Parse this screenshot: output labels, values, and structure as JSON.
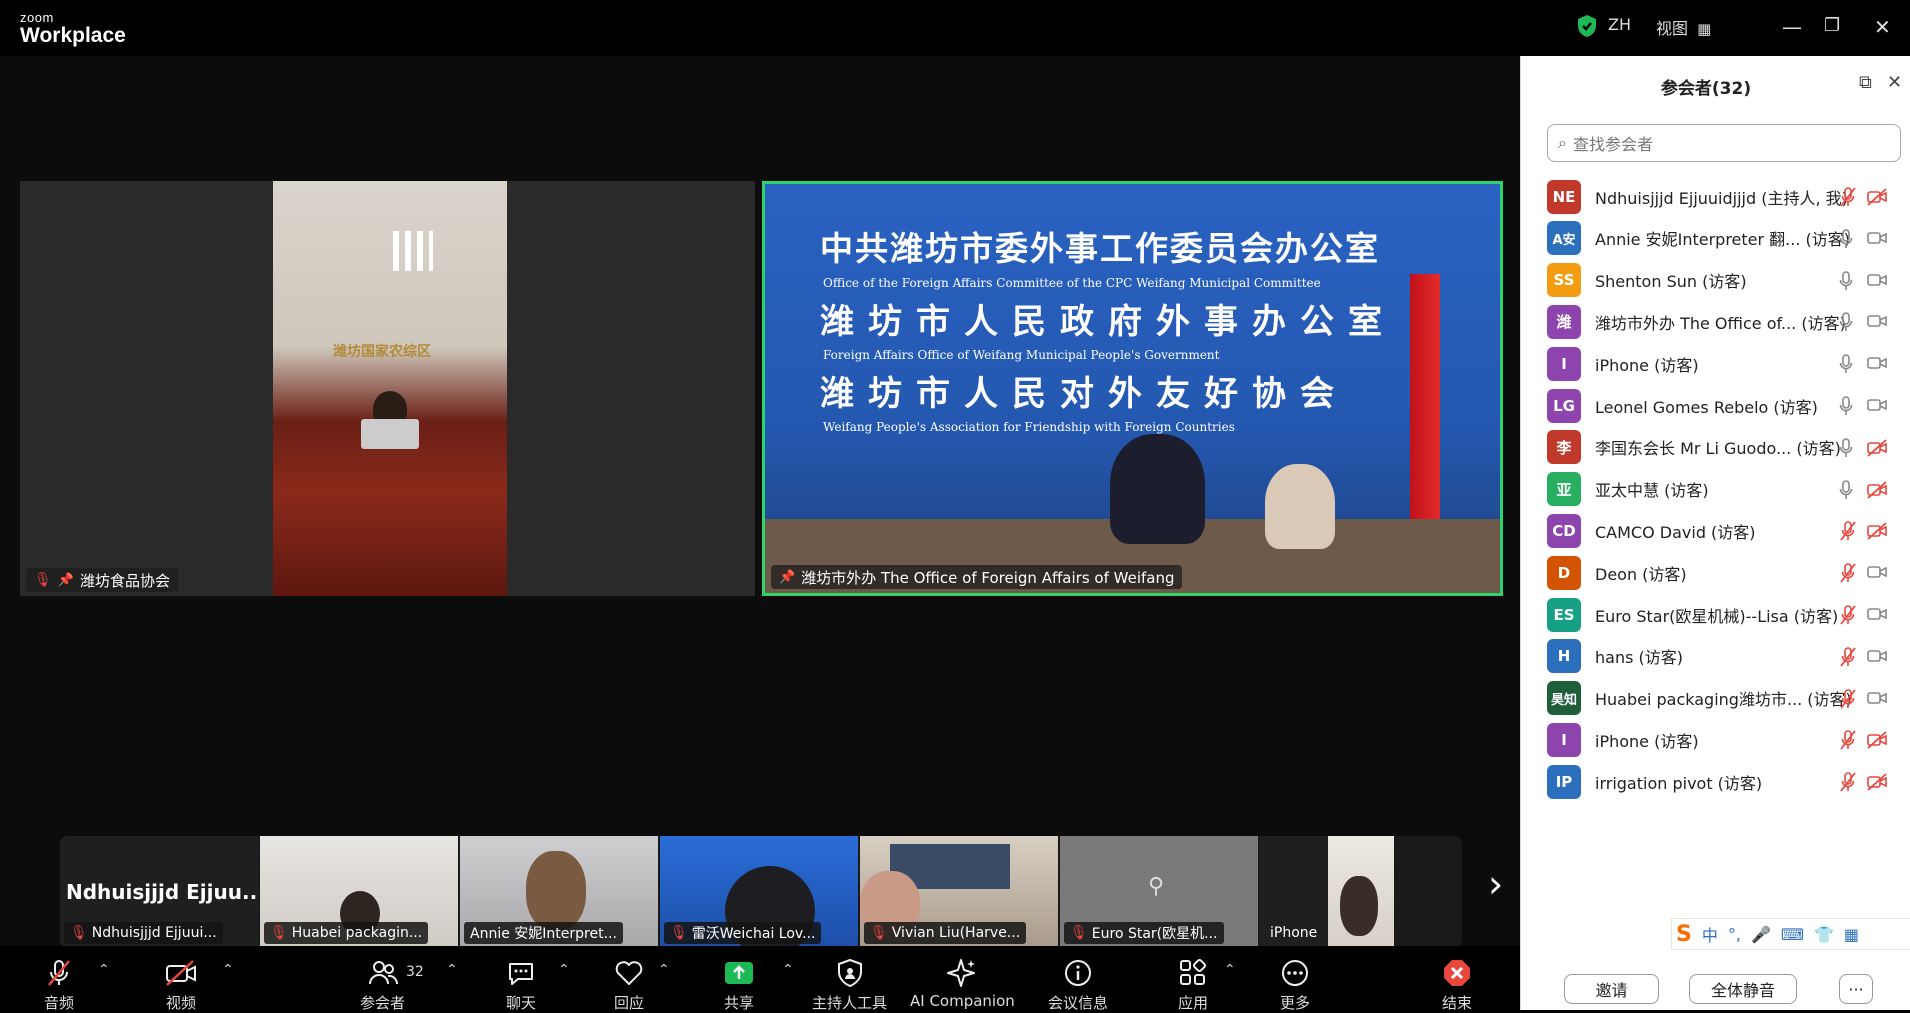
{
  "titlebar": {
    "logo_small": "zoom",
    "logo_big": "Workplace",
    "lang": "ZH",
    "view_label": "视图",
    "shield_color": "#1db954"
  },
  "main_tiles": [
    {
      "label": "潍坊食品协会"
    },
    {
      "label": "潍坊市外办 The Office of Foreign Affairs of Weifang",
      "banner_cn1": "中共潍坊市委外事工作委员会办公室",
      "banner_en1": "Office of the Foreign Affairs Committee of the CPC Weifang Municipal Committee",
      "banner_cn2": "潍坊市人民政府外事办公室",
      "banner_en2": "Foreign Affairs Office of Weifang Municipal People's Government",
      "banner_cn3": "潍坊市人民对外友好协会",
      "banner_en3": "Weifang People's Association for Friendship with Foreign Countries",
      "room_sign": "潍坊国家农综区"
    }
  ],
  "filmstrip": {
    "first_name_display": "Ndhuisjjjd  Ejjuu...",
    "thumbs": [
      {
        "label": "Ndhuisjjjd Ejjuui..."
      },
      {
        "label": "Huabei packagin..."
      },
      {
        "label": "Annie 安妮Interpret..."
      },
      {
        "label": "雷沃Weichai Lov..."
      },
      {
        "label": "Vivian Liu(Harve..."
      },
      {
        "label": "Euro Star(欧星机..."
      },
      {
        "label": "iPhone"
      }
    ],
    "next_icon": "›"
  },
  "toolbar": {
    "audio": "音频",
    "video": "视频",
    "participants": "参会者",
    "participants_count": "32",
    "chat": "聊天",
    "react": "回应",
    "share": "共享",
    "host_tools": "主持人工具",
    "ai": "AI Companion",
    "meeting_info": "会议信息",
    "apps": "应用",
    "more": "更多",
    "end": "结束"
  },
  "panel": {
    "title": "参会者(32)",
    "search_placeholder": "查找参会者",
    "invite": "邀请",
    "mute_all": "全体静音",
    "more": "···",
    "participants": [
      {
        "initials": "NE",
        "color": "#c0392b",
        "name": "Ndhuisjjjd Ejjuuidjjjd (主持人, 我)",
        "mic": "off",
        "cam": "off"
      },
      {
        "initials": "A安",
        "color": "#2c6fbd",
        "name": "Annie 安妮Interpreter 翻... (访客)",
        "mic": "on",
        "cam": "on"
      },
      {
        "initials": "SS",
        "color": "#f39c12",
        "name": "Shenton Sun (访客)",
        "mic": "on",
        "cam": "on"
      },
      {
        "initials": "潍",
        "color": "#8e44ad",
        "name": "潍坊市外办 The Office of... (访客)",
        "mic": "on",
        "cam": "on"
      },
      {
        "initials": "I",
        "color": "#8e44ad",
        "name": "iPhone (访客)",
        "mic": "on",
        "cam": "on"
      },
      {
        "initials": "LG",
        "color": "#8e44ad",
        "name": "Leonel Gomes Rebelo (访客)",
        "mic": "on",
        "cam": "on"
      },
      {
        "initials": "李",
        "color": "#c0392b",
        "name": "李国东会长 Mr Li Guodo... (访客)",
        "mic": "on",
        "cam": "off"
      },
      {
        "initials": "亚",
        "color": "#27ae60",
        "name": "亚太中慧 (访客)",
        "mic": "on",
        "cam": "off"
      },
      {
        "initials": "CD",
        "color": "#8e44ad",
        "name": "CAMCO David (访客)",
        "mic": "off",
        "cam": "off"
      },
      {
        "initials": "D",
        "color": "#d35400",
        "name": "Deon (访客)",
        "mic": "off",
        "cam": "on"
      },
      {
        "initials": "ES",
        "color": "#16a085",
        "name": "Euro Star(欧星机械)--Lisa (访客)",
        "mic": "off",
        "cam": "on"
      },
      {
        "initials": "H",
        "color": "#2c6fbd",
        "name": "hans (访客)",
        "mic": "off",
        "cam": "on"
      },
      {
        "initials": "昊知",
        "color": "#1e5e3a",
        "name": "Huabei packaging潍坊市... (访客)",
        "mic": "off",
        "cam": "on"
      },
      {
        "initials": "I",
        "color": "#8e44ad",
        "name": "iPhone (访客)",
        "mic": "off",
        "cam": "off"
      },
      {
        "initials": "IP",
        "color": "#2c6fbd",
        "name": "irrigation pivot (访客)",
        "mic": "off",
        "cam": "off"
      }
    ]
  },
  "ime": {
    "label": "中"
  }
}
